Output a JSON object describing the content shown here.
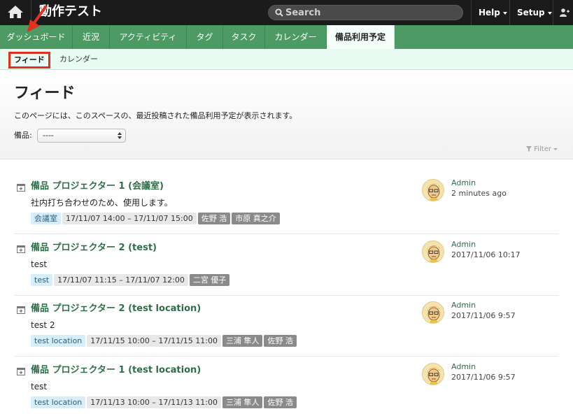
{
  "topbar": {
    "app_title": "動作テスト",
    "search_placeholder": "Search",
    "help_label": "Help",
    "setup_label": "Setup",
    "icons": [
      "home-icon",
      "search-icon",
      "user-add-icon"
    ]
  },
  "tabs": [
    {
      "label": "ダッシュボード"
    },
    {
      "label": "近況"
    },
    {
      "label": "アクティビティ"
    },
    {
      "label": "タグ"
    },
    {
      "label": "タスク"
    },
    {
      "label": "カレンダー"
    },
    {
      "label": "備品利用予定"
    }
  ],
  "subnav": {
    "feed_label": "フィード",
    "calendar_label": "カレンダー"
  },
  "page": {
    "title": "フィード",
    "description": "このページには、このスペースの、最近投稿された備品利用予定が表示されます。",
    "filter_label": "備品:",
    "filter_value": "----",
    "filter_link": "Filter"
  },
  "feed": [
    {
      "title": "備品 プロジェクター 1 (会議室)",
      "body": "社内打ち合わせのため、使用します。",
      "location": "会議室",
      "period": "17/11/07 14:00 – 17/11/07 15:00",
      "users": [
        "佐野 浩",
        "市原 真之介"
      ],
      "author": "Admin",
      "time": "2 minutes ago"
    },
    {
      "title": "備品 プロジェクター 2 (test)",
      "body": "test",
      "location": "test",
      "period": "17/11/07 11:15 – 17/11/07 12:00",
      "users": [
        "二宮 優子"
      ],
      "author": "Admin",
      "time": "2017/11/06 10:17"
    },
    {
      "title": "備品 プロジェクター 2 (test location)",
      "body": "test 2",
      "location": "test location",
      "period": "17/11/15 10:00 – 17/11/15 11:00",
      "users": [
        "三浦 隼人",
        "佐野 浩"
      ],
      "author": "Admin",
      "time": "2017/11/06 9:57"
    },
    {
      "title": "備品 プロジェクター 1 (test location)",
      "body": "test",
      "location": "test location",
      "period": "17/11/13 10:00 – 17/11/13 11:00",
      "users": [
        "三浦 隼人",
        "佐野 浩"
      ],
      "author": "Admin",
      "time": "2017/11/06 9:57"
    }
  ],
  "colors": {
    "topbar": "#1b1b1b",
    "tabbar": "#4e9a65",
    "link": "#2e6e46",
    "annotation": "#e0321f"
  }
}
